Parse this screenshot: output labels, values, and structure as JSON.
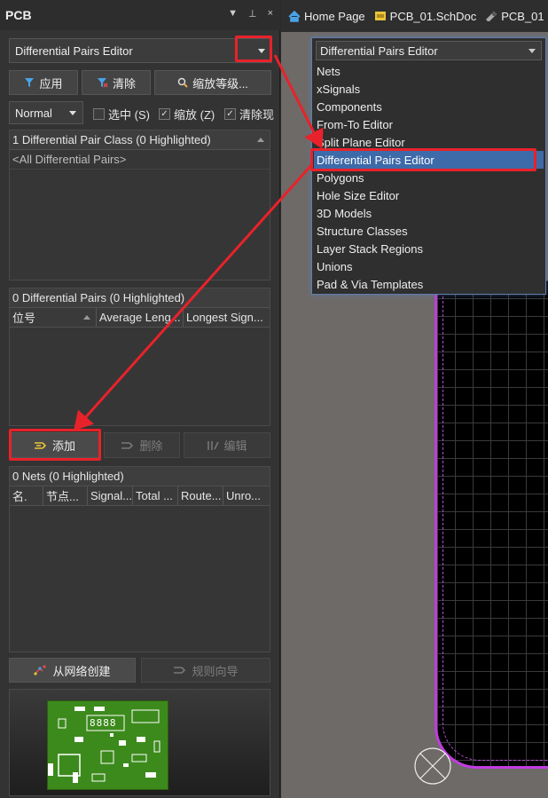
{
  "panel": {
    "title": "PCB",
    "title_controls": [
      "▼",
      "⊥",
      "×"
    ],
    "mode_select": {
      "value": "Differential Pairs Editor"
    },
    "buttons": {
      "apply": "应用",
      "clear": "清除",
      "zoom_level": "缩放等级..."
    },
    "filter_select": {
      "value": "Normal"
    },
    "checks": {
      "select": {
        "label": "选中 (S)",
        "checked": false
      },
      "zoom": {
        "label": "缩放 (Z)",
        "checked": true
      },
      "clear_existing": {
        "label": "清除现",
        "checked": true
      }
    },
    "class_section": {
      "header": "1 Differential Pair Class (0 Highlighted)",
      "rows": [
        "<All Differential Pairs>"
      ]
    },
    "pairs_section": {
      "header": "0 Differential Pairs (0 Highlighted)",
      "columns": [
        "位号",
        "Average Leng...",
        "Longest Sign..."
      ]
    },
    "pair_buttons": {
      "add": "添加",
      "delete": "删除",
      "edit": "编辑"
    },
    "nets_section": {
      "header": "0 Nets (0 Highlighted)",
      "columns": [
        "名.",
        "节点...",
        "Signal...",
        "Total ...",
        "Route...",
        "Unro..."
      ]
    },
    "bottom_buttons": {
      "create_from_nets": "从网络创建",
      "rule_wizard": "规则向导"
    },
    "board_text": "8888"
  },
  "tabs": [
    {
      "label": "Home Page",
      "icon": "home-icon"
    },
    {
      "label": "PCB_01.SchDoc",
      "icon": "schematic-doc-icon"
    },
    {
      "label": "PCB_01",
      "icon": "pcb-doc-icon"
    }
  ],
  "dropdown": {
    "value": "Differential Pairs Editor",
    "items": [
      "Nets",
      "xSignals",
      "Components",
      "From-To Editor",
      "Split Plane Editor",
      "Differential Pairs Editor",
      "Polygons",
      "Hole Size Editor",
      "3D Models",
      "Structure Classes",
      "Layer Stack Regions",
      "Unions",
      "Pad & Via Templates"
    ],
    "selected_index": 5
  },
  "colors": {
    "highlight": "#e8222a",
    "selection": "#3d6aa8",
    "board_outline": "#c23ce0",
    "pcb_green": "#3c8a1c"
  }
}
